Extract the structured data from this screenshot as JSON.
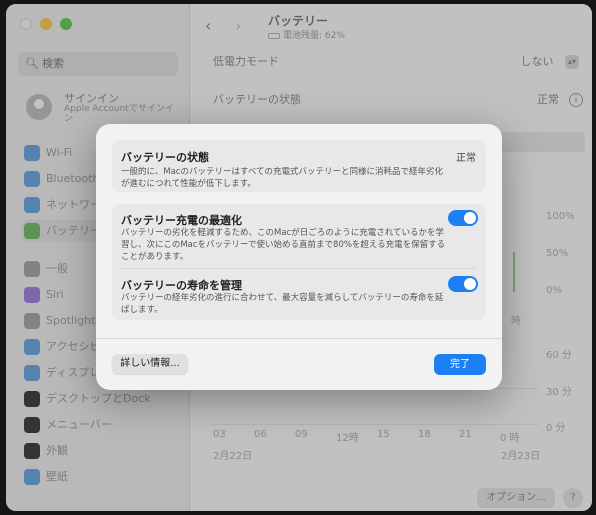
{
  "window": {
    "title": "バッテリー",
    "subtitle": "電池残量: 62%"
  },
  "sidebar": {
    "search_placeholder": "検索",
    "signin_title": "サインイン",
    "signin_sub": "Apple Accountでサインイン",
    "items": [
      {
        "label": "Wi-Fi",
        "icon": "wifi-icon",
        "color": "#6b9fd6"
      },
      {
        "label": "Bluetooth",
        "icon": "bluetooth-icon",
        "color": "#6b9fd6"
      },
      {
        "label": "ネットワーク",
        "icon": "network-icon",
        "color": "#6b9fd6"
      },
      {
        "label": "バッテリー",
        "icon": "battery-icon",
        "color": "#74b36a"
      },
      {
        "label": "一般",
        "icon": "general-icon",
        "color": "#a0a0a0"
      },
      {
        "label": "Siri",
        "icon": "siri-icon",
        "color": "#9b7ed6"
      },
      {
        "label": "Spotlight",
        "icon": "spotlight-icon",
        "color": "#a0a0a0"
      },
      {
        "label": "アクセシビリティ",
        "icon": "accessibility-icon",
        "color": "#6b9fd6"
      },
      {
        "label": "ディスプレイ",
        "icon": "display-icon",
        "color": "#6b9fd6"
      },
      {
        "label": "デスクトップとDock",
        "icon": "dock-icon",
        "color": "#404040"
      },
      {
        "label": "メニューバー",
        "icon": "menubar-icon",
        "color": "#404040"
      },
      {
        "label": "外観",
        "icon": "appearance-icon",
        "color": "#404040"
      },
      {
        "label": "壁紙",
        "icon": "wallpaper-icon",
        "color": "#6b9fd6"
      }
    ]
  },
  "main": {
    "low_power_label": "低電力モード",
    "low_power_value": "しない",
    "health_label": "バッテリーの状態",
    "health_value": "正常",
    "chart_pct": [
      "100%",
      "50%",
      "0%"
    ],
    "chart_min": [
      "60 分",
      "30 分",
      "0 分"
    ],
    "x_ticks": [
      "03",
      "06",
      "09",
      "12時",
      "15",
      "18",
      "21",
      "0 時"
    ],
    "partial_tick": "時",
    "dates": [
      "2月22日",
      "2月23日"
    ],
    "options_label": "オプション...",
    "help_label": "?"
  },
  "modal": {
    "health": {
      "title": "バッテリーの状態",
      "status": "正常",
      "desc": "一般的に、Macのバッテリーはすべての充電式バッテリーと同様に消耗品で経年劣化が進むにつれて性能が低下します。"
    },
    "optimize": {
      "title": "バッテリー充電の最適化",
      "desc": "バッテリーの劣化を軽減するため、このMacが日ごろのように充電されているかを学習し、次にこのMacをバッテリーで使い始める直前まで80%を超える充電を保留することがあります。",
      "enabled": true
    },
    "longevity": {
      "title": "バッテリーの寿命を管理",
      "desc": "バッテリーの経年劣化の進行に合わせて、最大容量を減らしてバッテリーの寿命を延ばします。",
      "enabled": true
    },
    "info_button": "詳しい情報...",
    "done_button": "完了"
  }
}
